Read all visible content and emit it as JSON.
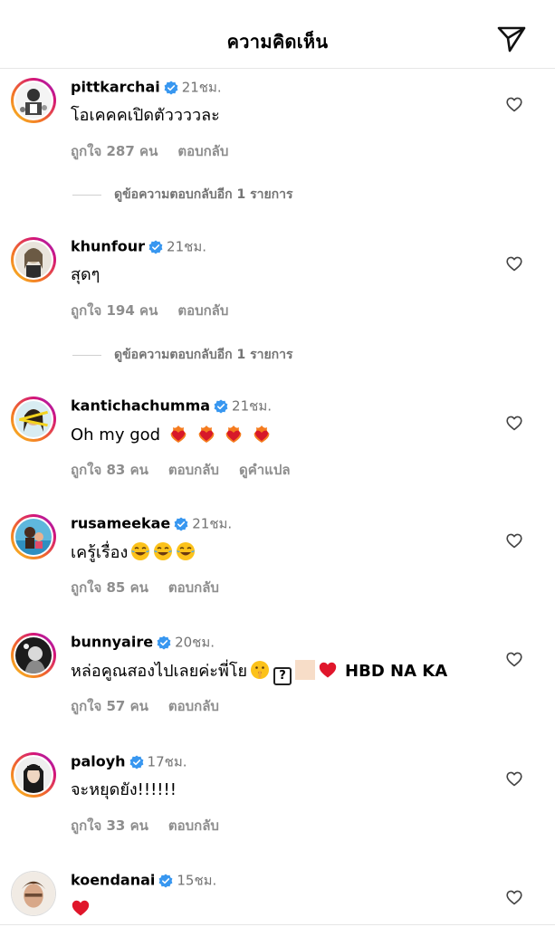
{
  "header": {
    "title": "ความคิดเห็น"
  },
  "icons": {
    "send": "send-icon",
    "heart": "heart-outline-icon",
    "verified": "verified-badge-icon"
  },
  "colors": {
    "verified": "#3897f0",
    "muted": "#737373",
    "heart_emoji": "#e0162b"
  },
  "comments": [
    {
      "username": "pittkarchai",
      "time": "21ชม.",
      "text": "โอเคคคเปิดตัววววละ",
      "likes": "ถูกใจ 287 คน",
      "reply": "ตอบกลับ",
      "translate": "",
      "view_replies": "ดูข้อความตอบกลับอีก 1 รายการ"
    },
    {
      "username": "khunfour",
      "time": "21ชม.",
      "text": "สุดๆ",
      "likes": "ถูกใจ 194 คน",
      "reply": "ตอบกลับ",
      "translate": "",
      "view_replies": "ดูข้อความตอบกลับอีก 1 รายการ"
    },
    {
      "username": "kantichachumma",
      "time": "21ชม.",
      "text": "Oh my god",
      "likes": "ถูกใจ 83 คน",
      "reply": "ตอบกลับ",
      "translate": "ดูคำแปล",
      "view_replies": ""
    },
    {
      "username": "rusameekae",
      "time": "21ชม.",
      "text": "เครู้เรื่อง",
      "likes": "ถูกใจ 85 คน",
      "reply": "ตอบกลับ",
      "translate": "",
      "view_replies": ""
    },
    {
      "username": "bunnyaire",
      "time": "20ชม.",
      "text": "หล่อคูณสองไปเลยค่ะพี่โย",
      "text_suffix": "HBD NA KA",
      "box_glyph": "?",
      "likes": "ถูกใจ 57 คน",
      "reply": "ตอบกลับ",
      "translate": "",
      "view_replies": ""
    },
    {
      "username": "paloyh",
      "time": "17ชม.",
      "text": "จะหยุดยัง!!!!!!",
      "likes": "ถูกใจ 33 คน",
      "reply": "ตอบกลับ",
      "translate": "",
      "view_replies": ""
    },
    {
      "username": "koendanai",
      "time": "15ชม.",
      "text": "",
      "likes": "",
      "reply": "",
      "translate": "",
      "view_replies": ""
    }
  ]
}
